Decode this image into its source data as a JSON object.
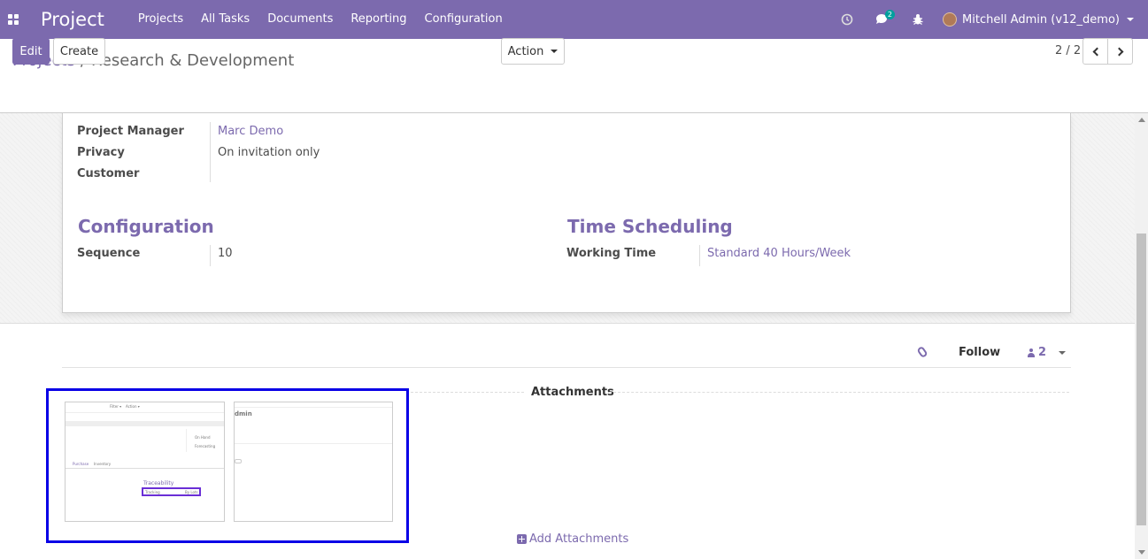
{
  "navbar": {
    "app_title": "Project",
    "menu": [
      "Projects",
      "All Tasks",
      "Documents",
      "Reporting",
      "Configuration"
    ],
    "message_count": "2",
    "user_name": "Mitchell Admin (v12_demo)"
  },
  "breadcrumb": {
    "parent": "Projects",
    "separator": "/",
    "current": "Research & Development"
  },
  "buttons": {
    "edit": "Edit",
    "create": "Create",
    "action": "Action"
  },
  "pager": {
    "value": "2 / 2"
  },
  "form": {
    "project_manager_label": "Project Manager",
    "project_manager_value": "Marc Demo",
    "privacy_label": "Privacy",
    "privacy_value": "On invitation only",
    "customer_label": "Customer",
    "customer_value": "",
    "configuration_title": "Configuration",
    "sequence_label": "Sequence",
    "sequence_value": "10",
    "time_scheduling_title": "Time Scheduling",
    "working_time_label": "Working Time",
    "working_time_value": "Standard 40 Hours/Week"
  },
  "chatter": {
    "follow": "Follow",
    "followers_count": "2",
    "attachments_title": "Attachments",
    "add_attachments": "Add Attachments"
  },
  "thumbnails": {
    "t1_lines": [
      "Filter ▾",
      "Action ▾",
      "On Hand",
      "Forecasting",
      "Purchase",
      "Inventory",
      "Traceability",
      "Tracking",
      "By Lots"
    ],
    "t2_lines": [
      "dmin"
    ]
  },
  "colors": {
    "brand": "#7c6aae",
    "highlight_box": "#0a00e6",
    "badge": "#00a09d"
  }
}
